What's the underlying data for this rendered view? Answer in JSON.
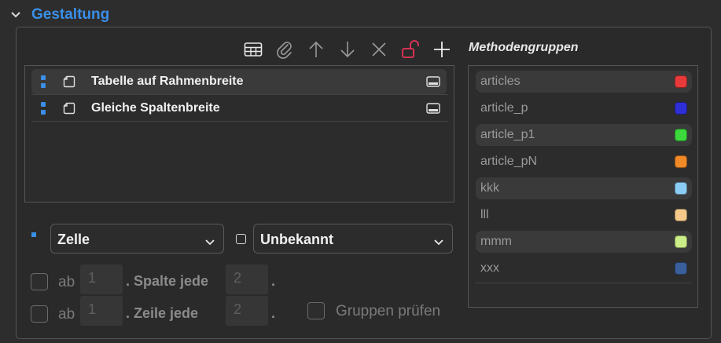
{
  "section": {
    "title": "Gestaltung",
    "icon": "chevron-down-icon"
  },
  "toolbar": {
    "buttons": [
      {
        "name": "table-icon"
      },
      {
        "name": "paperclip-icon"
      },
      {
        "name": "arrow-up-icon"
      },
      {
        "name": "arrow-down-icon"
      },
      {
        "name": "close-icon"
      },
      {
        "name": "unlock-icon",
        "color": "#e8335a"
      },
      {
        "name": "plus-icon"
      }
    ]
  },
  "methods_panel": {
    "title": "Methodengruppen",
    "groups": [
      {
        "label": "articles",
        "color": "#e83a3a"
      },
      {
        "label": "article_p",
        "color": "#2f2fd8"
      },
      {
        "label": "article_p1",
        "color": "#3cd83c"
      },
      {
        "label": "article_pN",
        "color": "#f08a26"
      },
      {
        "label": "kkk",
        "color": "#8ccdf5"
      },
      {
        "label": "lll",
        "color": "#f5c98a"
      },
      {
        "label": "mmm",
        "color": "#ccee88"
      },
      {
        "label": "xxx",
        "color": "#3a5f9a"
      }
    ]
  },
  "list": {
    "items": [
      {
        "label": "Tabelle auf Rahmenbreite",
        "selected": true
      },
      {
        "label": "Gleiche Spaltenbreite",
        "selected": false
      }
    ]
  },
  "controls": {
    "cell_select": "Zelle",
    "state_select": "Unbekannt",
    "row1": {
      "prefix": "ab",
      "start": "1",
      "mid": ". Spalte jede",
      "every": "2",
      "suffix": "."
    },
    "row2": {
      "prefix": "ab",
      "start": "1",
      "mid": ". Zeile jede",
      "every": "2",
      "suffix": "."
    },
    "check_groups_label": "Gruppen prüfen"
  }
}
